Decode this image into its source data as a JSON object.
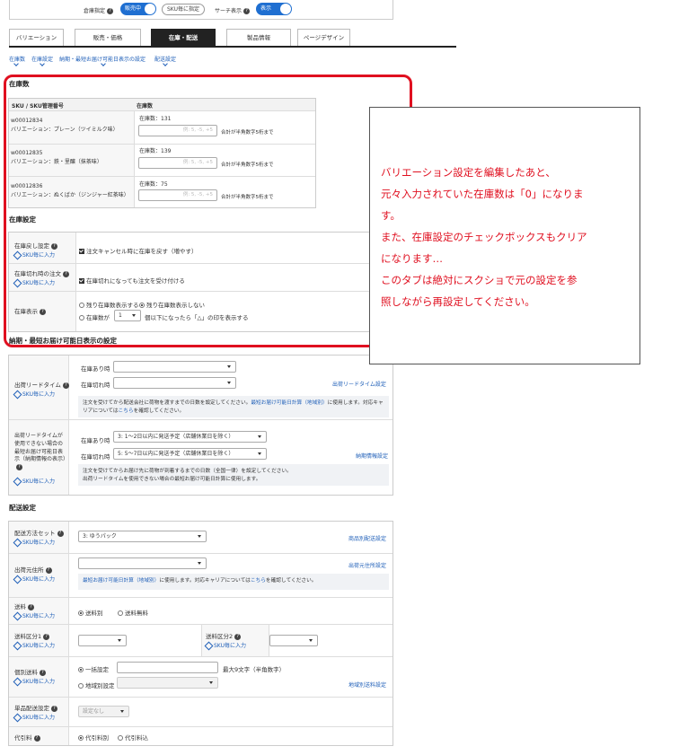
{
  "topbar": {
    "stock_label": "倉庫指定",
    "stock_toggle": "販売中",
    "sku_button": "SKU毎に指定",
    "search_label": "サーチ表示",
    "search_toggle": "表示"
  },
  "tabs": [
    "バリエーション",
    "販売・価格",
    "在庫・配送",
    "製品情報",
    "ページデザイン"
  ],
  "active_tab": "在庫・配送",
  "anchors": [
    "在庫数",
    "在庫設定",
    "納期・最短お届け可能日表示の設定",
    "配送設定"
  ],
  "inventory": {
    "heading": "在庫数",
    "col_sku": "SKU / SKU管理番号",
    "col_qty": "在庫数",
    "rows": [
      {
        "id": "w00012834",
        "variation": "バリエーション：プレーン（ツイミルク味）",
        "qty_label": "在庫数：131",
        "placeholder": "例: 5, -5, +5",
        "hint": "合計が半角数字5桁まで"
      },
      {
        "id": "w00012835",
        "variation": "バリエーション：鉄・里醸（抹茶味）",
        "qty_label": "在庫数：139",
        "placeholder": "例: 5, -5, +5",
        "hint": "合計が半角数字5桁まで"
      },
      {
        "id": "w00012836",
        "variation": "バリエーション：ぬくばか（ジンジャー紅茶味）",
        "qty_label": "在庫数：75",
        "placeholder": "例: 5, -5, +5",
        "hint": "合計が半角数字5桁まで"
      }
    ]
  },
  "stock_settings": {
    "heading": "在庫設定",
    "return_label": "在庫戻し設定",
    "return_option": "注文キャンセル時に在庫を戻す（増やす）",
    "outofstock_label": "在庫切れ時の注文",
    "outofstock_option": "在庫切れになっても注文を受け付ける",
    "display_label": "在庫表示",
    "display_opt1": "残り在庫数表示する",
    "display_opt2": "残り在庫数表示しない",
    "display_opt3_pre": "在庫数が",
    "display_opt3_val": "1",
    "display_opt3_post": "個以下になったら「△」の印を表示する",
    "sku_link": "SKU毎に入力"
  },
  "delivery_date": {
    "heading": "納期・最短お届け可能日表示の設定",
    "lead_label": "出荷リードタイム",
    "in_stock": "在庫あり時",
    "out_stock": "在庫切れ時",
    "lead_link": "出荷リードタイム設定",
    "lead_note1": "注文を受けてから配送会社に荷物を渡すまでの日数を設定してください。",
    "lead_note_link": "最短お届け可能日計算（地域別）",
    "lead_note2": "に使用します。対応キャリアについては",
    "lead_note_link2": "こちら",
    "lead_note3": "を確認してください。",
    "alt_label": "出荷リードタイムが使用できない場合の最短お届け可能日表示（納期情報の表示）",
    "alt_in_stock_value": "3: 1〜2日以内に発送予定（店舗休業日を除く）",
    "alt_out_stock_value": "5: 5〜7日以内に発送予定（店舗休業日を除く）",
    "alt_link": "納期情報設定",
    "alt_note1": "注文を受けてからお届け先に荷物が到着するまでの日数（全国一律）を設定してください。",
    "alt_note2": "出荷リードタイムを使用できない場合の最短お届け可能日計算に使用します。"
  },
  "shipping": {
    "heading": "配送設定",
    "method_label": "配送方法セット",
    "method_value": "3: ゆうパック",
    "method_link": "商品別配送設定",
    "origin_label": "出荷元住所",
    "origin_link": "出荷元住所設定",
    "origin_note_link": "最短お届け可能日計算（地域別）",
    "origin_note": "に使用します。対応キャリアについては",
    "origin_note_link2": "こちら",
    "origin_note3": "を確認してください。",
    "fee_label": "送料",
    "fee_opt1": "送料別",
    "fee_opt2": "送料無料",
    "class1_label": "送料区分1",
    "class2_label": "送料区分2",
    "indiv_label": "個別送料",
    "indiv_opt1": "一括設定",
    "indiv_opt2": "地域別設定",
    "indiv_hint": "最大9文字（半角数字）",
    "indiv_link": "地域別送料設定",
    "single_label": "単品配送設定",
    "single_value": "設定なし",
    "cod_label": "代引料",
    "cod_opt1": "代引料別",
    "cod_opt2": "代引料込",
    "sku_link": "SKU毎に入力"
  },
  "overlay_note": [
    "バリエーション設定を編集したあと、",
    "元々入力されていた在庫数は「0」になりま",
    "す。",
    "また、在庫設定のチェックボックスもクリア",
    "になります…",
    "このタブは絶対にスクショで元の設定を参",
    "照しながら再設定してください。"
  ],
  "colors": {
    "accent": "#1f6fd1",
    "highlight": "#e01020",
    "link": "#1f5fb8"
  }
}
